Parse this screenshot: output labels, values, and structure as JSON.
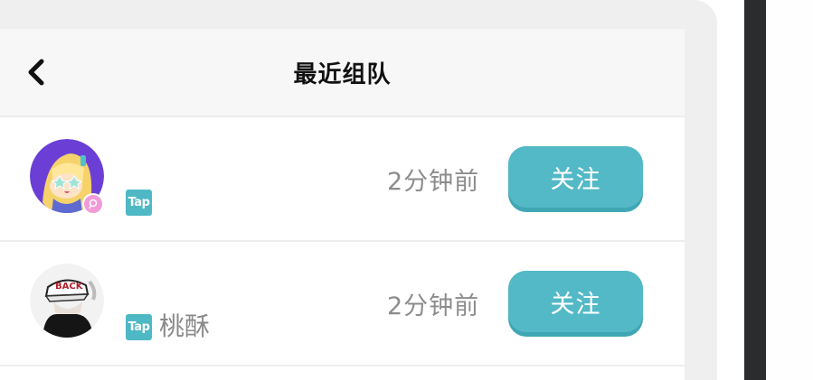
{
  "header": {
    "back_icon": "chevron-left-icon",
    "title": "最近组队"
  },
  "rows": [
    {
      "avatar_icon": "anime-avatar-icon",
      "badge": "Tap",
      "name": "",
      "time": "2分钟前",
      "follow_label": "关注"
    },
    {
      "avatar_icon": "hooded-avatar-icon",
      "badge": "Tap",
      "name": "桃酥",
      "time": "2分钟前",
      "follow_label": "关注"
    }
  ],
  "colors": {
    "accent": "#53b9c7",
    "badge": "#4fb8c5",
    "header_bg": "#f7f7f7"
  }
}
